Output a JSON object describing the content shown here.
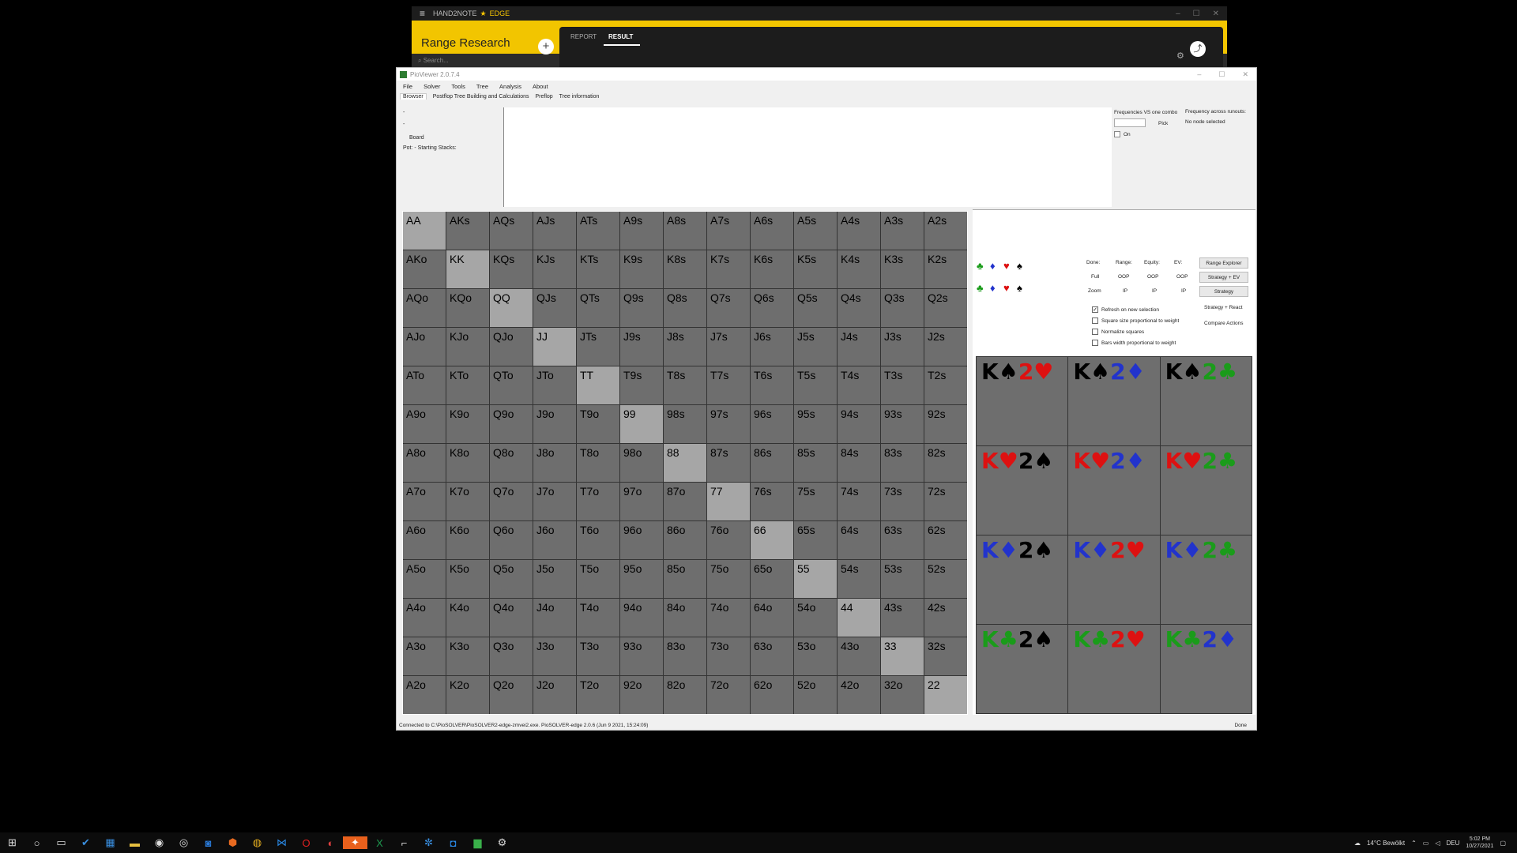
{
  "h2n": {
    "app_name": "HAND2NOTE",
    "edition": "EDGE",
    "section_title": "Range Research",
    "tabs": [
      "REPORT",
      "RESULT"
    ],
    "active_tab": "RESULT",
    "search_placeholder": "Search..."
  },
  "pio": {
    "title": "PioViewer 2.0.7.4",
    "menu": [
      "File",
      "Solver",
      "Tools",
      "Tree",
      "Analysis",
      "About"
    ],
    "tabs": [
      "Browser",
      "Postflop Tree Building and Calculations",
      "Preflop",
      "Tree information"
    ],
    "browser": {
      "dot1": "-",
      "dot2": "-",
      "board": "Board",
      "pot": "Pot: - Starting Stacks:"
    },
    "freq_vs": {
      "title": "Frequencies VS one combo",
      "pick": "Pick",
      "on_label": "On"
    },
    "freq_runouts": {
      "title": "Frequency across runouts:",
      "status": "No node selected"
    },
    "grid": [
      [
        "AA",
        "AKs",
        "AQs",
        "AJs",
        "ATs",
        "A9s",
        "A8s",
        "A7s",
        "A6s",
        "A5s",
        "A4s",
        "A3s",
        "A2s"
      ],
      [
        "AKo",
        "KK",
        "KQs",
        "KJs",
        "KTs",
        "K9s",
        "K8s",
        "K7s",
        "K6s",
        "K5s",
        "K4s",
        "K3s",
        "K2s"
      ],
      [
        "AQo",
        "KQo",
        "QQ",
        "QJs",
        "QTs",
        "Q9s",
        "Q8s",
        "Q7s",
        "Q6s",
        "Q5s",
        "Q4s",
        "Q3s",
        "Q2s"
      ],
      [
        "AJo",
        "KJo",
        "QJo",
        "JJ",
        "JTs",
        "J9s",
        "J8s",
        "J7s",
        "J6s",
        "J5s",
        "J4s",
        "J3s",
        "J2s"
      ],
      [
        "ATo",
        "KTo",
        "QTo",
        "JTo",
        "TT",
        "T9s",
        "T8s",
        "T7s",
        "T6s",
        "T5s",
        "T4s",
        "T3s",
        "T2s"
      ],
      [
        "A9o",
        "K9o",
        "Q9o",
        "J9o",
        "T9o",
        "99",
        "98s",
        "97s",
        "96s",
        "95s",
        "94s",
        "93s",
        "92s"
      ],
      [
        "A8o",
        "K8o",
        "Q8o",
        "J8o",
        "T8o",
        "98o",
        "88",
        "87s",
        "86s",
        "85s",
        "84s",
        "83s",
        "82s"
      ],
      [
        "A7o",
        "K7o",
        "Q7o",
        "J7o",
        "T7o",
        "97o",
        "87o",
        "77",
        "76s",
        "75s",
        "74s",
        "73s",
        "72s"
      ],
      [
        "A6o",
        "K6o",
        "Q6o",
        "J6o",
        "T6o",
        "96o",
        "86o",
        "76o",
        "66",
        "65s",
        "64s",
        "63s",
        "62s"
      ],
      [
        "A5o",
        "K5o",
        "Q5o",
        "J5o",
        "T5o",
        "95o",
        "85o",
        "75o",
        "65o",
        "55",
        "54s",
        "53s",
        "52s"
      ],
      [
        "A4o",
        "K4o",
        "Q4o",
        "J4o",
        "T4o",
        "94o",
        "84o",
        "74o",
        "64o",
        "54o",
        "44",
        "43s",
        "42s"
      ],
      [
        "A3o",
        "K3o",
        "Q3o",
        "J3o",
        "T3o",
        "93o",
        "83o",
        "73o",
        "63o",
        "53o",
        "43o",
        "33",
        "32s"
      ],
      [
        "A2o",
        "K2o",
        "Q2o",
        "J2o",
        "T2o",
        "92o",
        "82o",
        "72o",
        "62o",
        "52o",
        "42o",
        "32o",
        "22"
      ]
    ],
    "suits": [
      {
        "glyph": "♣",
        "color": "#1a9c1a"
      },
      {
        "glyph": "♦",
        "color": "#2233cc"
      },
      {
        "glyph": "♥",
        "color": "#dd1111"
      },
      {
        "glyph": "♠",
        "color": "#000000"
      }
    ],
    "stats": {
      "headers": [
        "Done:",
        "Range:",
        "Equity:",
        "EV:"
      ],
      "row_full": [
        "Full",
        "OOP",
        "OOP",
        "OOP"
      ],
      "row_zoom": [
        "Zoom",
        "IP",
        "IP",
        "IP"
      ]
    },
    "buttons": [
      "Range Explorer",
      "Strategy + EV",
      "Strategy",
      "Strategy + React",
      "Compare Actions"
    ],
    "options": [
      {
        "label": "Refresh on new selection",
        "checked": "✓"
      },
      {
        "label": "Square size proportional to weight",
        "checked": ""
      },
      {
        "label": "Normalize squares",
        "checked": ""
      },
      {
        "label": "Bars width proportional to weight",
        "checked": ""
      }
    ],
    "combos": [
      [
        {
          "r": "K",
          "s": "♠",
          "c": "#000000"
        },
        {
          "r": "2",
          "s": "♥",
          "c": "#dd1111"
        }
      ],
      [
        {
          "r": "K",
          "s": "♠",
          "c": "#000000"
        },
        {
          "r": "2",
          "s": "♦",
          "c": "#2233cc"
        }
      ],
      [
        {
          "r": "K",
          "s": "♠",
          "c": "#000000"
        },
        {
          "r": "2",
          "s": "♣",
          "c": "#1a9c1a"
        }
      ],
      [
        {
          "r": "K",
          "s": "♥",
          "c": "#dd1111"
        },
        {
          "r": "2",
          "s": "♠",
          "c": "#000000"
        }
      ],
      [
        {
          "r": "K",
          "s": "♥",
          "c": "#dd1111"
        },
        {
          "r": "2",
          "s": "♦",
          "c": "#2233cc"
        }
      ],
      [
        {
          "r": "K",
          "s": "♥",
          "c": "#dd1111"
        },
        {
          "r": "2",
          "s": "♣",
          "c": "#1a9c1a"
        }
      ],
      [
        {
          "r": "K",
          "s": "♦",
          "c": "#2233cc"
        },
        {
          "r": "2",
          "s": "♠",
          "c": "#000000"
        }
      ],
      [
        {
          "r": "K",
          "s": "♦",
          "c": "#2233cc"
        },
        {
          "r": "2",
          "s": "♥",
          "c": "#dd1111"
        }
      ],
      [
        {
          "r": "K",
          "s": "♦",
          "c": "#2233cc"
        },
        {
          "r": "2",
          "s": "♣",
          "c": "#1a9c1a"
        }
      ],
      [
        {
          "r": "K",
          "s": "♣",
          "c": "#1a9c1a"
        },
        {
          "r": "2",
          "s": "♠",
          "c": "#000000"
        }
      ],
      [
        {
          "r": "K",
          "s": "♣",
          "c": "#1a9c1a"
        },
        {
          "r": "2",
          "s": "♥",
          "c": "#dd1111"
        }
      ],
      [
        {
          "r": "K",
          "s": "♣",
          "c": "#1a9c1a"
        },
        {
          "r": "2",
          "s": "♦",
          "c": "#2233cc"
        }
      ]
    ],
    "status": "Connected to C:\\PioSOLVER\\PioSOLVER2-edge-zmvei2.exe. PioSOLVER-edge 2.0.6 (Jun  9 2021, 15:24:09)",
    "status_right": "Done"
  },
  "taskbar": {
    "icons": [
      "windows-start-icon",
      "search-icon",
      "task-view-icon",
      "todo-icon",
      "calendar-icon",
      "file-explorer-icon",
      "app-icon",
      "chrome-icon",
      "outlook-icon",
      "brave-icon",
      "chrome-alt-icon",
      "vscode-icon",
      "opera-icon",
      "gmail-icon",
      "hand2note-icon",
      "excel-icon",
      "pio-icon",
      "settings-app-icon",
      "zoom-icon",
      "piosolver-icon",
      "gear-icon"
    ],
    "weather": "14°C  Bewölkt",
    "lang": "DEU",
    "time": "5:02 PM",
    "date": "10/27/2021"
  }
}
